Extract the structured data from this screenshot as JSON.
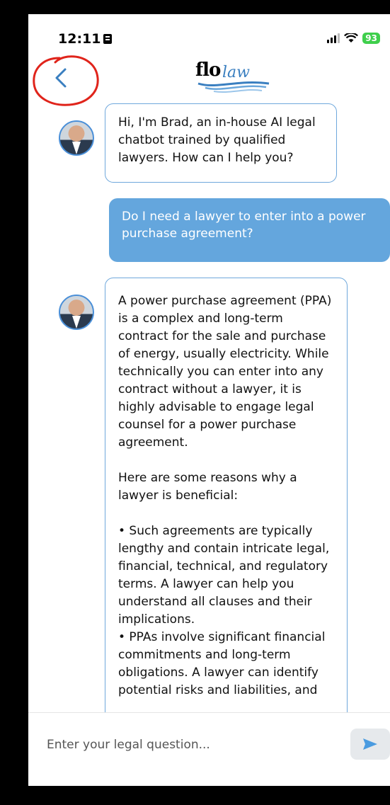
{
  "status_bar": {
    "time": "12:11",
    "battery": "93"
  },
  "header": {
    "logo_text": "flo",
    "logo_script": "law"
  },
  "chat": {
    "messages": [
      {
        "role": "bot",
        "text": "Hi, I'm Brad, an in-house AI legal chatbot trained by qualified lawyers. How can I help you?"
      },
      {
        "role": "user",
        "text": "Do I need a lawyer to enter into a power purchase agreement?"
      },
      {
        "role": "bot",
        "text": "A power purchase agreement (PPA) is a complex and long-term contract for the sale and purchase of energy, usually electricity. While technically you can enter into any contract without a lawyer, it is highly advisable to engage legal counsel for a power purchase agreement.\n\nHere are some reasons why a lawyer is beneficial:\n\n• Such agreements are typically lengthy and contain intricate legal, financial, technical, and regulatory terms. A lawyer can help you understand all clauses and their implications.\n• PPAs involve significant financial commitments and long-term obligations. A lawyer can identify potential risks and liabilities, and"
      }
    ]
  },
  "input": {
    "placeholder": "Enter your legal question..."
  },
  "colors": {
    "accent": "#64a6dd",
    "bot_border": "#6fa8dc",
    "annotation": "#e0241b"
  }
}
